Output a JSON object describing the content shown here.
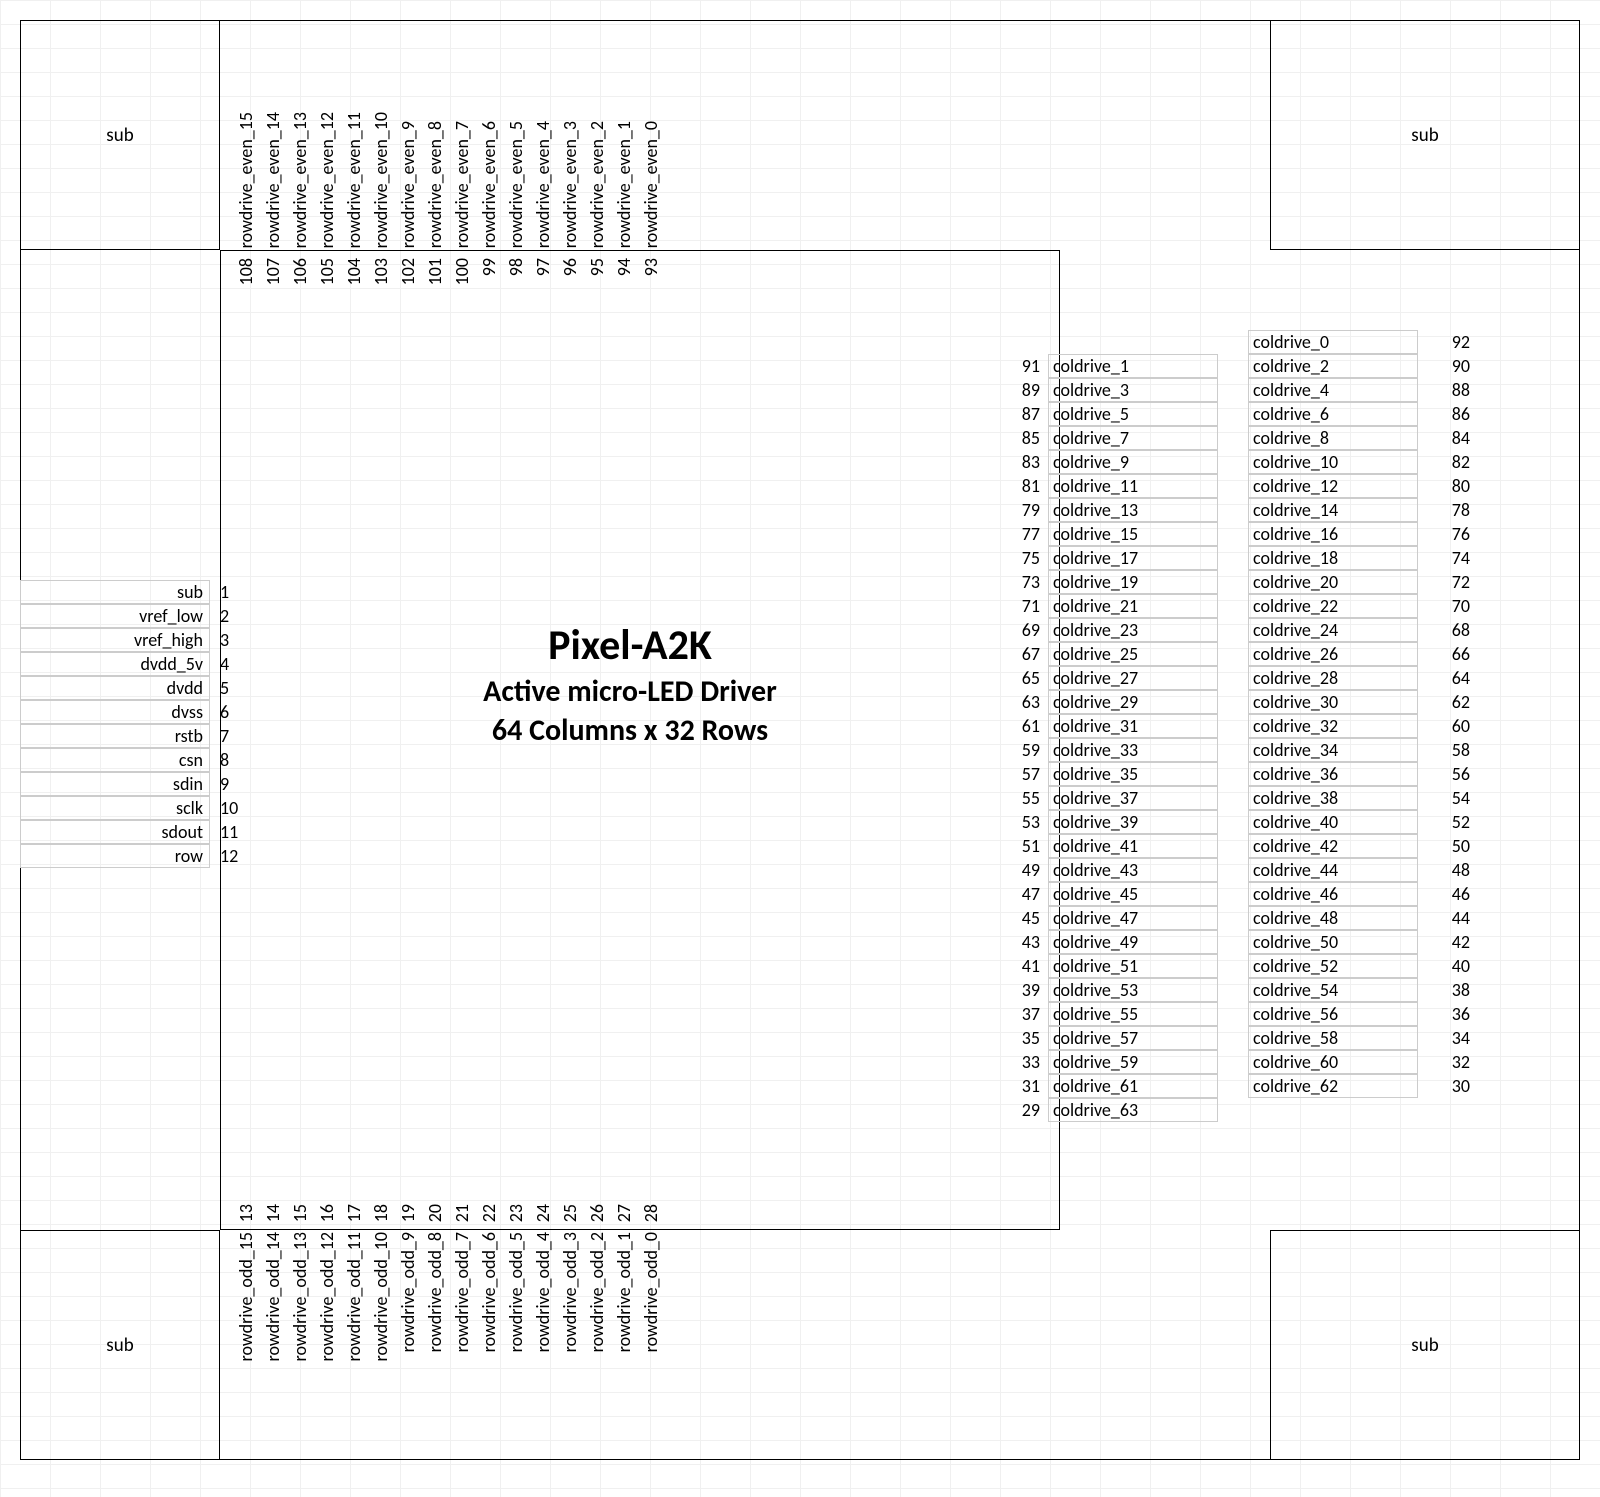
{
  "corners": {
    "sub": "sub"
  },
  "title": {
    "main": "Pixel-A2K",
    "line2": "Active micro-LED Driver",
    "line3": "64 Columns x 32 Rows"
  },
  "top_rowdrive": {
    "labels": [
      "rowdrive_even_15",
      "rowdrive_even_14",
      "rowdrive_even_13",
      "rowdrive_even_12",
      "rowdrive_even_11",
      "rowdrive_even_10",
      "rowdrive_even_9",
      "rowdrive_even_8",
      "rowdrive_even_7",
      "rowdrive_even_6",
      "rowdrive_even_5",
      "rowdrive_even_4",
      "rowdrive_even_3",
      "rowdrive_even_2",
      "rowdrive_even_1",
      "rowdrive_even_0"
    ],
    "pins": [
      108,
      107,
      106,
      105,
      104,
      103,
      102,
      101,
      100,
      99,
      98,
      97,
      96,
      95,
      94,
      93
    ]
  },
  "bottom_rowdrive": {
    "labels": [
      "rowdrive_odd_15",
      "rowdrive_odd_14",
      "rowdrive_odd_13",
      "rowdrive_odd_12",
      "rowdrive_odd_11",
      "rowdrive_odd_10",
      "rowdrive_odd_9",
      "rowdrive_odd_8",
      "rowdrive_odd_7",
      "rowdrive_odd_6",
      "rowdrive_odd_5",
      "rowdrive_odd_4",
      "rowdrive_odd_3",
      "rowdrive_odd_2",
      "rowdrive_odd_1",
      "rowdrive_odd_0"
    ],
    "pins": [
      13,
      14,
      15,
      16,
      17,
      18,
      19,
      20,
      21,
      22,
      23,
      24,
      25,
      26,
      27,
      28
    ]
  },
  "left_signals": [
    {
      "name": "sub",
      "pin": 1
    },
    {
      "name": "vref_low",
      "pin": 2
    },
    {
      "name": "vref_high",
      "pin": 3
    },
    {
      "name": "dvdd_5v",
      "pin": 4
    },
    {
      "name": "dvdd",
      "pin": 5
    },
    {
      "name": "dvss",
      "pin": 6
    },
    {
      "name": "rstb",
      "pin": 7
    },
    {
      "name": "csn",
      "pin": 8
    },
    {
      "name": "sdin",
      "pin": 9
    },
    {
      "name": "sclk",
      "pin": 10
    },
    {
      "name": "sdout",
      "pin": 11
    },
    {
      "name": "row",
      "pin": 12
    }
  ],
  "coldrive_top": {
    "name": "coldrive_0",
    "pin": 92
  },
  "coldrive_pairs": [
    {
      "lpin": 91,
      "lname": "coldrive_1",
      "rname": "coldrive_2",
      "rpin": 90
    },
    {
      "lpin": 89,
      "lname": "coldrive_3",
      "rname": "coldrive_4",
      "rpin": 88
    },
    {
      "lpin": 87,
      "lname": "coldrive_5",
      "rname": "coldrive_6",
      "rpin": 86
    },
    {
      "lpin": 85,
      "lname": "coldrive_7",
      "rname": "coldrive_8",
      "rpin": 84
    },
    {
      "lpin": 83,
      "lname": "coldrive_9",
      "rname": "coldrive_10",
      "rpin": 82
    },
    {
      "lpin": 81,
      "lname": "coldrive_11",
      "rname": "coldrive_12",
      "rpin": 80
    },
    {
      "lpin": 79,
      "lname": "coldrive_13",
      "rname": "coldrive_14",
      "rpin": 78
    },
    {
      "lpin": 77,
      "lname": "coldrive_15",
      "rname": "coldrive_16",
      "rpin": 76
    },
    {
      "lpin": 75,
      "lname": "coldrive_17",
      "rname": "coldrive_18",
      "rpin": 74
    },
    {
      "lpin": 73,
      "lname": "coldrive_19",
      "rname": "coldrive_20",
      "rpin": 72
    },
    {
      "lpin": 71,
      "lname": "coldrive_21",
      "rname": "coldrive_22",
      "rpin": 70
    },
    {
      "lpin": 69,
      "lname": "coldrive_23",
      "rname": "coldrive_24",
      "rpin": 68
    },
    {
      "lpin": 67,
      "lname": "coldrive_25",
      "rname": "coldrive_26",
      "rpin": 66
    },
    {
      "lpin": 65,
      "lname": "coldrive_27",
      "rname": "coldrive_28",
      "rpin": 64
    },
    {
      "lpin": 63,
      "lname": "coldrive_29",
      "rname": "coldrive_30",
      "rpin": 62
    },
    {
      "lpin": 61,
      "lname": "coldrive_31",
      "rname": "coldrive_32",
      "rpin": 60
    },
    {
      "lpin": 59,
      "lname": "coldrive_33",
      "rname": "coldrive_34",
      "rpin": 58
    },
    {
      "lpin": 57,
      "lname": "coldrive_35",
      "rname": "coldrive_36",
      "rpin": 56
    },
    {
      "lpin": 55,
      "lname": "coldrive_37",
      "rname": "coldrive_38",
      "rpin": 54
    },
    {
      "lpin": 53,
      "lname": "coldrive_39",
      "rname": "coldrive_40",
      "rpin": 52
    },
    {
      "lpin": 51,
      "lname": "coldrive_41",
      "rname": "coldrive_42",
      "rpin": 50
    },
    {
      "lpin": 49,
      "lname": "coldrive_43",
      "rname": "coldrive_44",
      "rpin": 48
    },
    {
      "lpin": 47,
      "lname": "coldrive_45",
      "rname": "coldrive_46",
      "rpin": 46
    },
    {
      "lpin": 45,
      "lname": "coldrive_47",
      "rname": "coldrive_48",
      "rpin": 44
    },
    {
      "lpin": 43,
      "lname": "coldrive_49",
      "rname": "coldrive_50",
      "rpin": 42
    },
    {
      "lpin": 41,
      "lname": "coldrive_51",
      "rname": "coldrive_52",
      "rpin": 40
    },
    {
      "lpin": 39,
      "lname": "coldrive_53",
      "rname": "coldrive_54",
      "rpin": 38
    },
    {
      "lpin": 37,
      "lname": "coldrive_55",
      "rname": "coldrive_56",
      "rpin": 36
    },
    {
      "lpin": 35,
      "lname": "coldrive_57",
      "rname": "coldrive_58",
      "rpin": 34
    },
    {
      "lpin": 33,
      "lname": "coldrive_59",
      "rname": "coldrive_60",
      "rpin": 32
    },
    {
      "lpin": 31,
      "lname": "coldrive_61",
      "rname": "coldrive_62",
      "rpin": 30
    }
  ],
  "coldrive_bottom": {
    "name": "coldrive_63",
    "pin": 29
  }
}
